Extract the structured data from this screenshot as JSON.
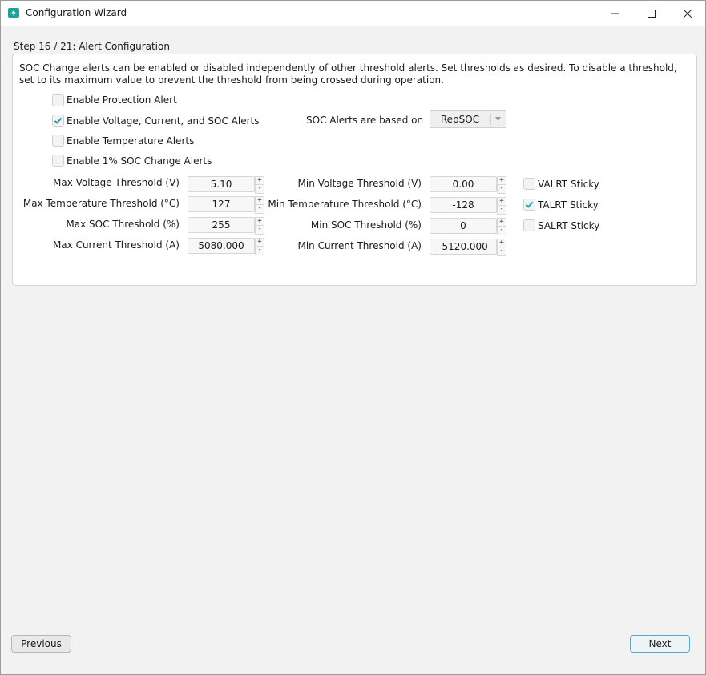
{
  "window": {
    "title": "Configuration Wizard",
    "app_icon": "battery-charge-icon"
  },
  "step_label": "Step 16 / 21: Alert Configuration",
  "description": "SOC Change alerts can be enabled or disabled independently of other threshold alerts. Set thresholds as desired. To disable a threshold, set to its maximum value to prevent the threshold from being crossed during operation.",
  "options": {
    "protection": {
      "label": "Enable Protection Alert",
      "checked": false
    },
    "vcs": {
      "label": "Enable Voltage, Current, and SOC Alerts",
      "checked": true
    },
    "temperature": {
      "label": "Enable Temperature Alerts",
      "checked": false
    },
    "soc_change": {
      "label": "Enable 1% SOC Change Alerts",
      "checked": false
    }
  },
  "soc_basis": {
    "label": "SOC Alerts are based on",
    "value": "RepSOC"
  },
  "thresholds": {
    "max_voltage": {
      "label": "Max Voltage Threshold (V)",
      "value": "5.10"
    },
    "max_temperature": {
      "label": "Max Temperature Threshold (°C)",
      "value": "127"
    },
    "max_soc": {
      "label": "Max SOC Threshold (%)",
      "value": "255"
    },
    "max_current": {
      "label": "Max Current Threshold (A)",
      "value": "5080.000"
    },
    "min_voltage": {
      "label": "Min Voltage Threshold (V)",
      "value": "0.00"
    },
    "min_temperature": {
      "label": "Min Temperature Threshold (°C)",
      "value": "-128"
    },
    "min_soc": {
      "label": "Min SOC Threshold (%)",
      "value": "0"
    },
    "min_current": {
      "label": "Min Current Threshold (A)",
      "value": "-5120.000"
    }
  },
  "sticky": {
    "valrt": {
      "label": "VALRT Sticky",
      "checked": false
    },
    "talrt": {
      "label": "TALRT Sticky",
      "checked": true
    },
    "salrt": {
      "label": "SALRT Sticky",
      "checked": false
    }
  },
  "spin": {
    "up": "+",
    "down": "-"
  },
  "buttons": {
    "previous": "Previous",
    "next": "Next"
  },
  "colors": {
    "check": "#1a9bb0",
    "accent_border": "#5aa7c9",
    "app_icon": "#1aa39a"
  }
}
